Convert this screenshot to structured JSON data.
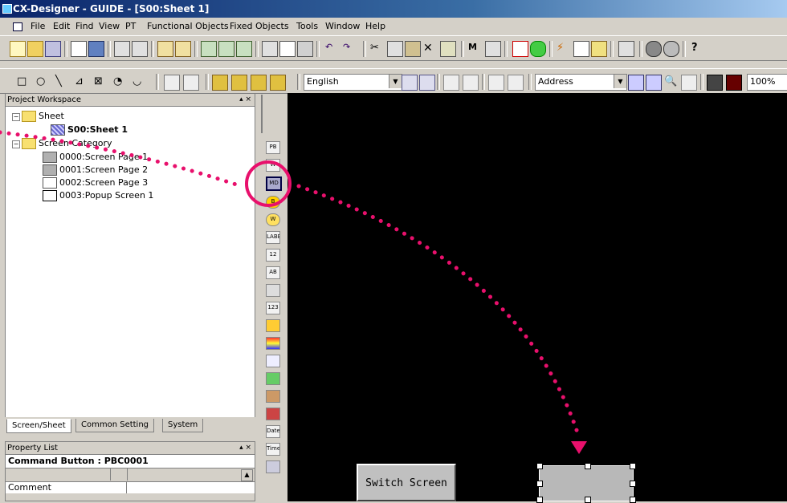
{
  "window": {
    "title": "CX-Designer - GUIDE - [S00:Sheet 1]"
  },
  "menu": [
    "File",
    "Edit",
    "Find",
    "View",
    "PT",
    "Functional Objects",
    "Fixed Objects",
    "Tools",
    "Window",
    "Help"
  ],
  "toolbar": {
    "language": "English",
    "address_mode": "Address",
    "zoom": "100%"
  },
  "workspace": {
    "title": "Project Workspace",
    "tree": {
      "sheet_folder": "Sheet",
      "sheet_item": "S00:Sheet 1",
      "category_folder": "Screen Category",
      "pages": [
        "0000:Screen Page 1",
        "0001:Screen Page 2",
        "0002:Screen Page 3",
        "0003:Popup Screen 1"
      ]
    },
    "tabs": [
      "Screen/Sheet",
      "Common Setting",
      "System"
    ]
  },
  "property_list": {
    "title": "Property List",
    "object": "Command Button : PBC0001",
    "rows": [
      "Comment"
    ]
  },
  "object_bar": {
    "labels": [
      "PB",
      "W",
      "MD",
      "B",
      "W",
      "LABEL",
      "12",
      "AB",
      "",
      "123",
      "",
      "",
      "",
      "",
      "",
      "",
      "Date",
      "Time",
      ""
    ]
  },
  "canvas": {
    "existing_button_label": "Switch Screen"
  },
  "annotation": {
    "color": "#e8106c"
  }
}
